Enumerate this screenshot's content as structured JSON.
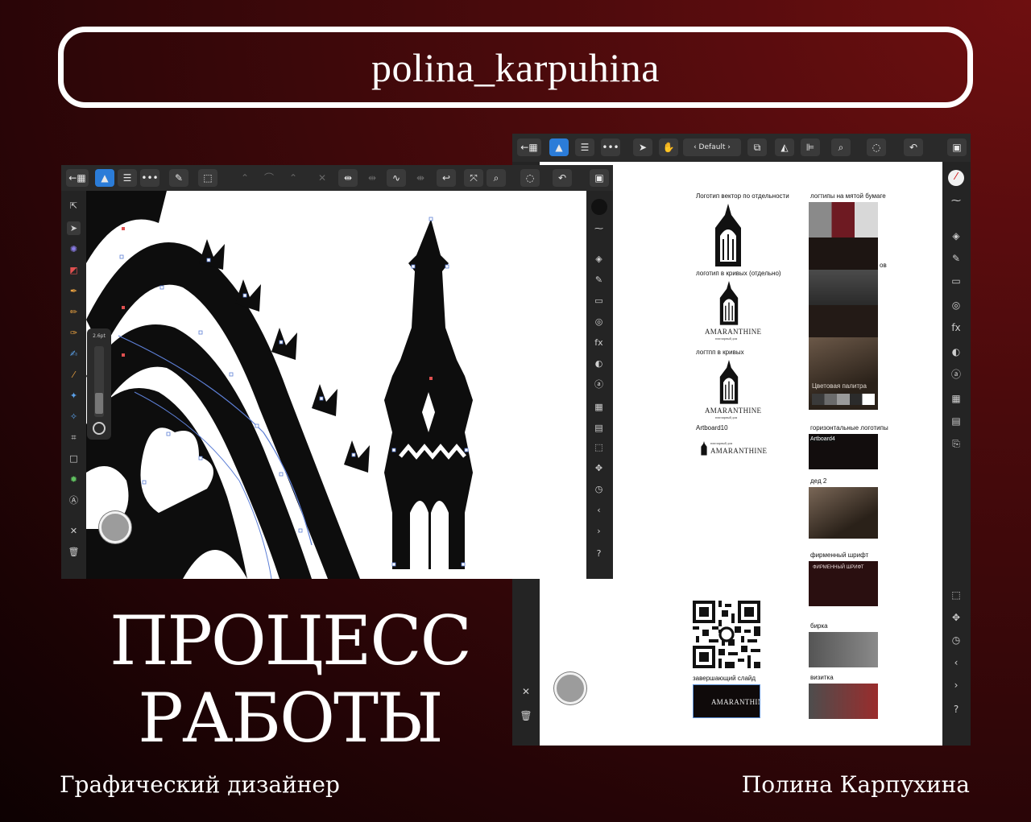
{
  "header": {
    "username": "polina_karpuhina"
  },
  "app_toolbar": {
    "preset_label": "Default"
  },
  "stroke_panel": {
    "width_label": "2.6pt"
  },
  "artboards": {
    "logo_vector": "Логотип вектор по отдельности",
    "logo_crumpled": "логтипы на мятой бумаге",
    "logo_curves_separate": "логотип в кривых (отдельно)",
    "logo_curves": "логтпп в кривых",
    "artboard10": "Artboard10",
    "horizontal_logos": "горизонтальные логотипы",
    "ded2": "дед 2",
    "brand_font": "фирменный шрифт",
    "tag": "бирка",
    "closing_slide": "завершающий слайд",
    "business_card": "визитка"
  },
  "brand_name": "AMARANTHINE",
  "brand_subtitle": "ювелирный дом",
  "thumb_texts": {
    "palette": "Цветовая палитра",
    "horizontal_tag": "Artboard4",
    "font": "ФИРМЕННЫЙ ШРИФТ",
    "cropped_suffix": "ов"
  },
  "headline": {
    "line1": "ПРОЦЕСС",
    "line2": "РАБОТЫ"
  },
  "footer": {
    "role": "Графический дизайнер",
    "name": "Полина Карпухина"
  },
  "colors": {
    "accent": "#2b7cd8",
    "background_dark": "#2a0507",
    "background_red": "#6e0f10"
  }
}
